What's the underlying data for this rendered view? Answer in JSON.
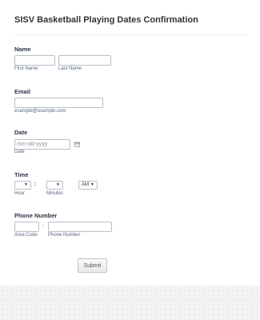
{
  "form": {
    "title": "SISV Basketball Playing Dates Confirmation",
    "name": {
      "label": "Name",
      "first_sublabel": "First Name",
      "last_sublabel": "Last Name",
      "first_value": "",
      "last_value": ""
    },
    "email": {
      "label": "Email",
      "value": "",
      "sublabel": "example@example.com"
    },
    "date": {
      "label": "Date",
      "placeholder": "mm-dd-yyyy",
      "sublabel": "Date",
      "icon": "calendar-icon"
    },
    "time": {
      "label": "Time",
      "hour_value": "",
      "minutes_value": "",
      "separator": ":",
      "ampm_value": "AM",
      "hour_sublabel": "Hour",
      "minutes_sublabel": "Minutes",
      "arrow": "▼"
    },
    "phone": {
      "label": "Phone Number",
      "separator": "-",
      "area_sublabel": "Area Code",
      "number_sublabel": "Phone Number",
      "area_value": "",
      "number_value": ""
    },
    "submit_label": "Submit"
  }
}
